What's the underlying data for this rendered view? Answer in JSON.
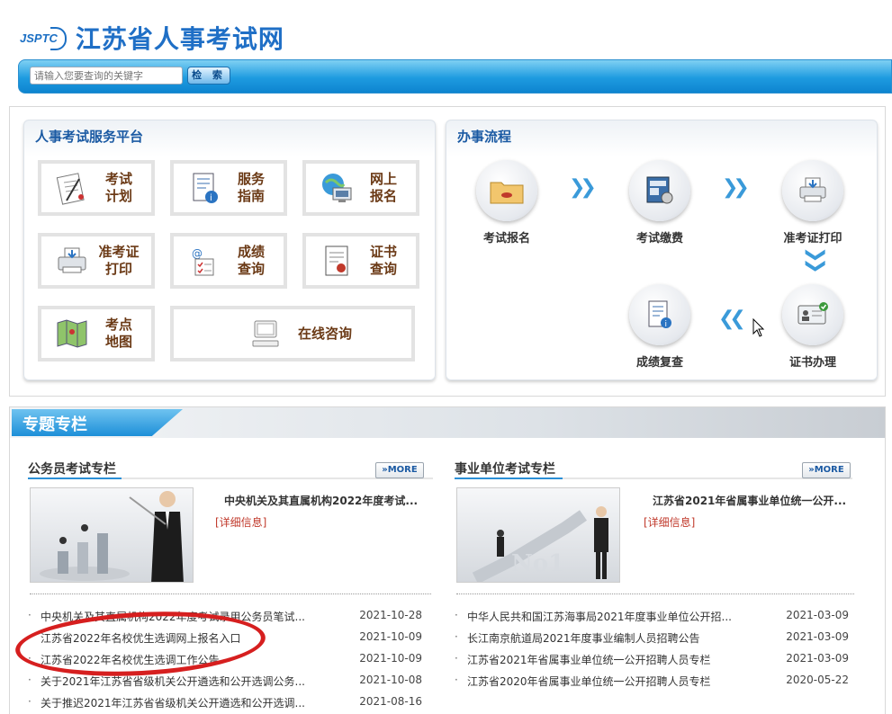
{
  "header": {
    "logo_mark": "JSPTC",
    "site_title": "江苏省人事考试网"
  },
  "search": {
    "placeholder": "请输入您要查询的关键字",
    "button_label": "检 索"
  },
  "service_platform": {
    "title": "人事考试服务平台",
    "items": [
      {
        "label": "考试\n计划",
        "icon": "exam-plan-icon"
      },
      {
        "label": "服务\n指南",
        "icon": "guide-icon"
      },
      {
        "label": "网上\n报名",
        "icon": "online-register-icon"
      },
      {
        "label": "准考证\n打印",
        "icon": "printer-icon"
      },
      {
        "label": "成绩\n查询",
        "icon": "score-query-icon"
      },
      {
        "label": "证书\n查询",
        "icon": "certificate-icon"
      },
      {
        "label": "考点\n地图",
        "icon": "map-icon"
      },
      {
        "label": "在线咨询",
        "icon": "computer-icon"
      }
    ]
  },
  "process": {
    "title": "办事流程",
    "steps": [
      {
        "label": "考试报名",
        "icon": "folder-icon"
      },
      {
        "label": "考试缴费",
        "icon": "payment-icon"
      },
      {
        "label": "准考证打印",
        "icon": "printer-icon"
      },
      {
        "label": "证书办理",
        "icon": "id-card-icon"
      },
      {
        "label": "成绩复查",
        "icon": "report-icon"
      }
    ]
  },
  "special": {
    "title": "专题专栏",
    "more_label": "MORE",
    "civil": {
      "title": "公务员考试专栏",
      "feature_title": "中央机关及其直属机构2022年度考试...",
      "detail_label": "[详细信息]",
      "news": [
        {
          "title": "中央机关及其直属机构2022年度考试录用公务员笔试...",
          "date": "2021-10-28"
        },
        {
          "title": "江苏省2022年名校优生选调网上报名入口",
          "date": "2021-10-09"
        },
        {
          "title": "江苏省2022年名校优生选调工作公告",
          "date": "2021-10-09"
        },
        {
          "title": "关于2021年江苏省省级机关公开遴选和公开选调公务...",
          "date": "2021-10-08"
        },
        {
          "title": "关于推迟2021年江苏省省级机关公开遴选和公开选调...",
          "date": "2021-08-16"
        }
      ]
    },
    "public": {
      "title": "事业单位考试专栏",
      "feature_title": "江苏省2021年省属事业单位统一公开...",
      "detail_label": "[详细信息]",
      "news": [
        {
          "title": "中华人民共和国江苏海事局2021年度事业单位公开招...",
          "date": "2021-03-09"
        },
        {
          "title": "长江南京航道局2021年度事业编制人员招聘公告",
          "date": "2021-03-09"
        },
        {
          "title": "江苏省2021年省属事业单位统一公开招聘人员专栏",
          "date": "2021-03-09"
        },
        {
          "title": "江苏省2020年省属事业单位统一公开招聘人员专栏",
          "date": "2020-05-22"
        }
      ]
    }
  },
  "colors": {
    "brand_blue": "#1f6fc6",
    "label_brown": "#6b3a16",
    "annotation_red": "#d61f1f"
  }
}
